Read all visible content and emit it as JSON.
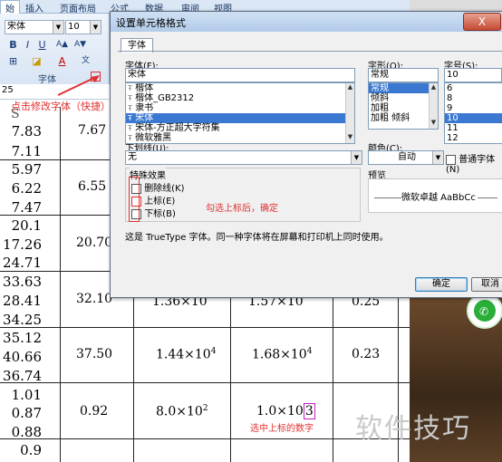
{
  "ribbon": {
    "tabs": [
      "始",
      "插入",
      "页面布局",
      "公式",
      "数据",
      "审阅",
      "视图"
    ],
    "font_name": "宋体",
    "font_size": "10",
    "group_label": "字体",
    "name_box": "25",
    "annotation_font_launcher": "点击修改字体（快捷）"
  },
  "sheet": {
    "col_header": "S",
    "left_values": [
      "7.83",
      "7.11",
      "5.97",
      "6.22",
      "7.47",
      "20.1",
      "17.26",
      "24.71",
      "33.63",
      "28.41",
      "34.25",
      "35.12",
      "40.66",
      "36.74",
      "1.01",
      "0.87",
      "0.88",
      "0.9"
    ],
    "col2_values": [
      "7.67",
      "6.55",
      "20.70",
      "32.10",
      "37.50",
      "0.92"
    ],
    "row_a": {
      "c3_base": "1.36×10",
      "c4_base": "1.57×10",
      "c5": "0.25"
    },
    "row_b": {
      "c3_base": "1.44×10",
      "c3_exp": "4",
      "c4_base": "1.68×10",
      "c4_exp": "4",
      "c5": "0.23"
    },
    "row_c": {
      "c3_base": "8.0×10",
      "c3_exp": "2",
      "c4_base": "1.0×10",
      "c4_exp": "3"
    },
    "annotation_select_digit": "选中上标的数字"
  },
  "dialog": {
    "title": "设置单元格格式",
    "close_label": "X",
    "tab": "字体",
    "font_label": "字体(F):",
    "font_value": "宋体",
    "font_list": [
      "楷体",
      "楷体_GB2312",
      "隶书",
      "宋体",
      "宋体-方正超大字符集",
      "微软雅黑"
    ],
    "style_label": "字形(O):",
    "style_value": "常规",
    "style_list": [
      "常规",
      "倾斜",
      "加粗",
      "加粗 倾斜"
    ],
    "size_label": "字号(S):",
    "size_value": "10",
    "size_list": [
      "6",
      "8",
      "9",
      "10",
      "11",
      "12"
    ],
    "underline_label": "下划线(U):",
    "underline_value": "无",
    "color_label": "颜色(C):",
    "color_value": "自动",
    "normal_font_label": "普通字体(N)",
    "effects_label": "特殊效果",
    "strike_label": "删除线(K)",
    "superscript_label": "上标(E)",
    "subscript_label": "下标(B)",
    "annotation_check": "勾选上标后，确定",
    "preview_label": "预览",
    "preview_text": "微软卓越  AaBbCc",
    "truetype_note": "这是 TrueType 字体。同一种字体将在屏幕和打印机上同时使用。",
    "ok_label": "确定",
    "cancel_label": "取消"
  },
  "watermark": "软件技巧",
  "colors": {
    "annotation_red": "#e03030",
    "selection_blue": "#3a78d2"
  }
}
